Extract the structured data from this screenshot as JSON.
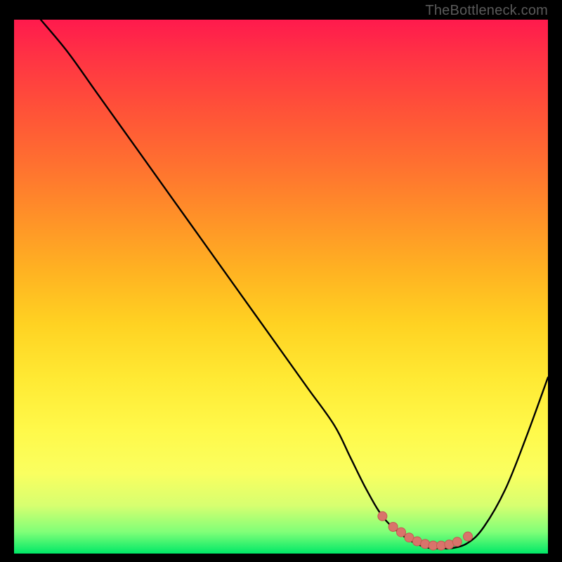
{
  "attribution": "TheBottleneck.com",
  "colors": {
    "frame": "#000000",
    "curve": "#000000",
    "marker_fill": "#d9746b",
    "marker_stroke": "#c55a52"
  },
  "chart_data": {
    "type": "line",
    "title": "",
    "xlabel": "",
    "ylabel": "",
    "xlim": [
      0,
      100
    ],
    "ylim": [
      0,
      100
    ],
    "grid": false,
    "series": [
      {
        "name": "bottleneck-curve",
        "x": [
          5,
          10,
          15,
          20,
          25,
          30,
          35,
          40,
          45,
          50,
          55,
          60,
          63,
          66,
          69,
          72,
          75,
          78,
          80,
          82,
          85,
          88,
          92,
          96,
          100
        ],
        "y": [
          100,
          94,
          87,
          80,
          73,
          66,
          59,
          52,
          45,
          38,
          31,
          24,
          18,
          12,
          7,
          4,
          2,
          1,
          1,
          1,
          2,
          5,
          12,
          22,
          33
        ]
      }
    ],
    "markers": {
      "name": "highlight-points",
      "x": [
        69,
        71,
        72.5,
        74,
        75.5,
        77,
        78.5,
        80,
        81.5,
        83,
        85
      ],
      "y": [
        7,
        5,
        4,
        3,
        2.3,
        1.8,
        1.5,
        1.5,
        1.7,
        2.2,
        3.2
      ]
    },
    "gradient_stops": [
      {
        "pos": 0,
        "color": "#ff1a4d"
      },
      {
        "pos": 50,
        "color": "#ffc225"
      },
      {
        "pos": 80,
        "color": "#fcff55"
      },
      {
        "pos": 100,
        "color": "#00e867"
      }
    ]
  }
}
